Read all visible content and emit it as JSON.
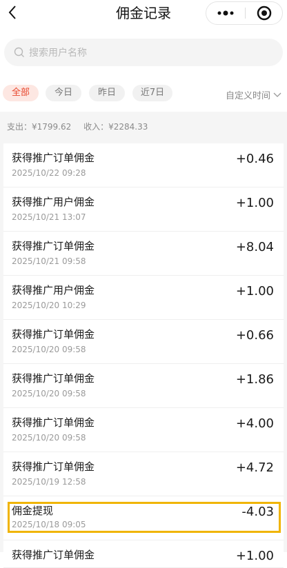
{
  "nav": {
    "title": "佣金记录"
  },
  "search": {
    "placeholder": "搜索用户名称"
  },
  "filters": {
    "chips": [
      "全部",
      "今日",
      "昨日",
      "近7日"
    ],
    "active": "全部",
    "custom_label": "自定义时间"
  },
  "summary": {
    "expense": "支出：¥1799.62",
    "income": "收入：¥2284.33"
  },
  "records": [
    {
      "label": "获得推广订单佣金",
      "time": "2025/10/22 09:28",
      "amount": "+0.46"
    },
    {
      "label": "获得推广用户佣金",
      "time": "2025/10/21 13:07",
      "amount": "+1.00"
    },
    {
      "label": "获得推广订单佣金",
      "time": "2025/10/21 09:58",
      "amount": "+8.04"
    },
    {
      "label": "获得推广用户佣金",
      "time": "2025/10/20 10:29",
      "amount": "+1.00"
    },
    {
      "label": "获得推广订单佣金",
      "time": "2025/10/20 09:58",
      "amount": "+0.66"
    },
    {
      "label": "获得推广订单佣金",
      "time": "2025/10/20 09:58",
      "amount": "+1.86"
    },
    {
      "label": "获得推广订单佣金",
      "time": "2025/10/20 09:58",
      "amount": "+4.00"
    },
    {
      "label": "获得推广订单佣金",
      "time": "2025/10/19 12:58",
      "amount": "+4.72"
    },
    {
      "label": "佣金提现",
      "time": "2025/10/18 09:05",
      "amount": "-4.03"
    },
    {
      "label": "获得推广订单佣金",
      "time": "",
      "amount": "+1.00"
    }
  ],
  "icons": {
    "back": "chevron-left-icon",
    "more": "more-dots-icon",
    "close": "target-close-icon",
    "search": "search-icon",
    "dropdown": "chevron-down-icon"
  },
  "colors": {
    "accent": "#e8482f",
    "highlight_box": "#f0b400"
  }
}
